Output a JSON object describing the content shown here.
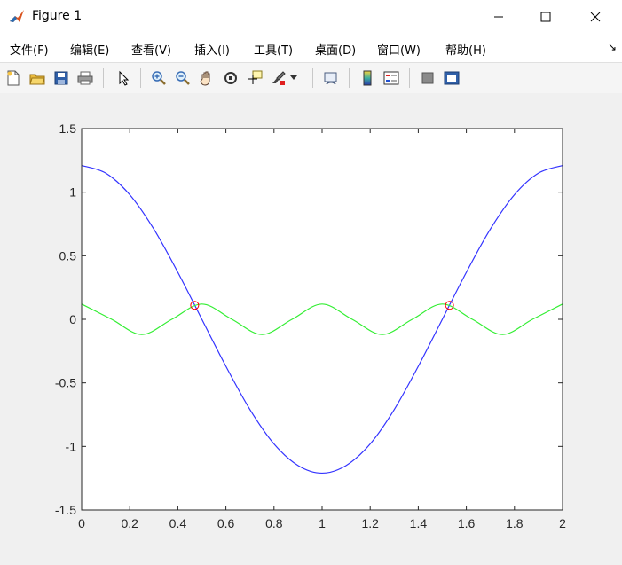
{
  "window": {
    "title": "Figure 1",
    "controls": [
      "minimize",
      "maximize",
      "close"
    ]
  },
  "menu": {
    "items": [
      {
        "label": "文件(F)"
      },
      {
        "label": "编辑(E)"
      },
      {
        "label": "查看(V)"
      },
      {
        "label": "插入(I)"
      },
      {
        "label": "工具(T)"
      },
      {
        "label": "桌面(D)"
      },
      {
        "label": "窗口(W)"
      },
      {
        "label": "帮助(H)"
      }
    ]
  },
  "toolbar": {
    "icons": [
      "new-figure-icon",
      "open-file-icon",
      "save-icon",
      "print-icon",
      "edit-plot-arrow-icon",
      "zoom-in-icon",
      "zoom-out-icon",
      "pan-hand-icon",
      "rotate-3d-icon",
      "data-cursor-icon",
      "brush-icon",
      "brush-dropdown-icon",
      "link-plot-icon",
      "insert-colorbar-icon",
      "insert-legend-icon",
      "hide-plot-tools-icon",
      "show-plot-tools-icon"
    ]
  },
  "chart_data": {
    "type": "line",
    "title": "",
    "xlabel": "",
    "ylabel": "",
    "xlim": [
      0,
      2
    ],
    "ylim": [
      -1.5,
      1.5
    ],
    "xticks": [
      "0",
      "0.2",
      "0.4",
      "0.6",
      "0.8",
      "1",
      "1.2",
      "1.4",
      "1.6",
      "1.8",
      "2"
    ],
    "yticks": [
      "-1.5",
      "-1",
      "-0.5",
      "0",
      "0.5",
      "1",
      "1.5"
    ],
    "grid": false,
    "series": [
      {
        "color": "#3333ff",
        "x": [
          0,
          0.1,
          0.2,
          0.3,
          0.4,
          0.5,
          0.6,
          0.7,
          0.8,
          0.9,
          1.0,
          1.1,
          1.2,
          1.3,
          1.4,
          1.5,
          1.6,
          1.7,
          1.8,
          1.9,
          2.0
        ],
        "y": [
          1.21,
          1.15,
          0.98,
          0.71,
          0.37,
          0.0,
          -0.37,
          -0.71,
          -0.98,
          -1.15,
          -1.21,
          -1.15,
          -0.98,
          -0.71,
          -0.37,
          0.0,
          0.37,
          0.71,
          0.98,
          1.15,
          1.21
        ]
      },
      {
        "color": "#33ee33",
        "x": [
          0,
          0.125,
          0.25,
          0.375,
          0.5,
          0.625,
          0.75,
          0.875,
          1.0,
          1.125,
          1.25,
          1.375,
          1.5,
          1.625,
          1.75,
          1.875,
          2.0
        ],
        "y": [
          0.12,
          0.0,
          -0.12,
          0.0,
          0.12,
          0.0,
          -0.12,
          0.0,
          0.12,
          0.0,
          -0.12,
          0.0,
          0.12,
          0.0,
          -0.12,
          0.0,
          0.12
        ]
      }
    ],
    "markers": {
      "color": "#ff0000",
      "shape": "circle",
      "points": [
        {
          "x": 0.47,
          "y": 0.11
        },
        {
          "x": 1.53,
          "y": 0.11
        }
      ]
    }
  }
}
